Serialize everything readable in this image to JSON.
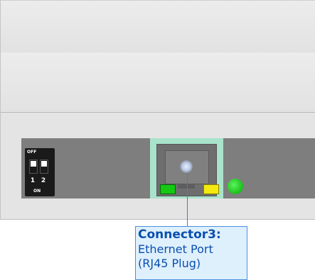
{
  "dip_switch": {
    "off_label": "OFF",
    "on_label": "ON",
    "switch_numbers": [
      "1",
      "2"
    ]
  },
  "callout": {
    "title": "Connector3:",
    "lines": [
      "Ethernet Port",
      "(RJ45 Plug)"
    ]
  },
  "colors": {
    "rj45_highlight": "#a9e3cc",
    "led_green": "#14c814",
    "led_yellow": "#f5ea10",
    "status_led": "#22c722",
    "callout_text": "#0a4fae",
    "callout_border": "#4a8fe0",
    "callout_background": "#dff0fd"
  }
}
